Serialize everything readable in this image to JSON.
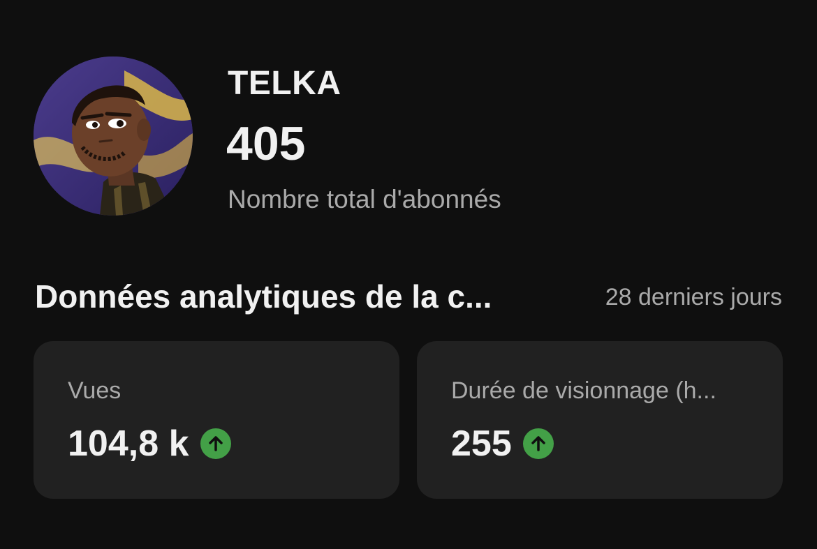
{
  "channel": {
    "name": "TELKA",
    "subscriber_count": "405",
    "subscriber_label": "Nombre total d'abonnés",
    "avatar_icon": "profile-avatar"
  },
  "analytics": {
    "title": "Données analytiques de la c...",
    "period": "28 derniers jours",
    "cards": [
      {
        "label": "Vues",
        "value": "104,8 k",
        "trend": "up"
      },
      {
        "label": "Durée de visionnage (h...",
        "value": "255",
        "trend": "up"
      }
    ]
  },
  "colors": {
    "background": "#0f0f0f",
    "card": "#212121",
    "trend_up": "#43a047",
    "secondary_text": "#aaaaaa"
  }
}
